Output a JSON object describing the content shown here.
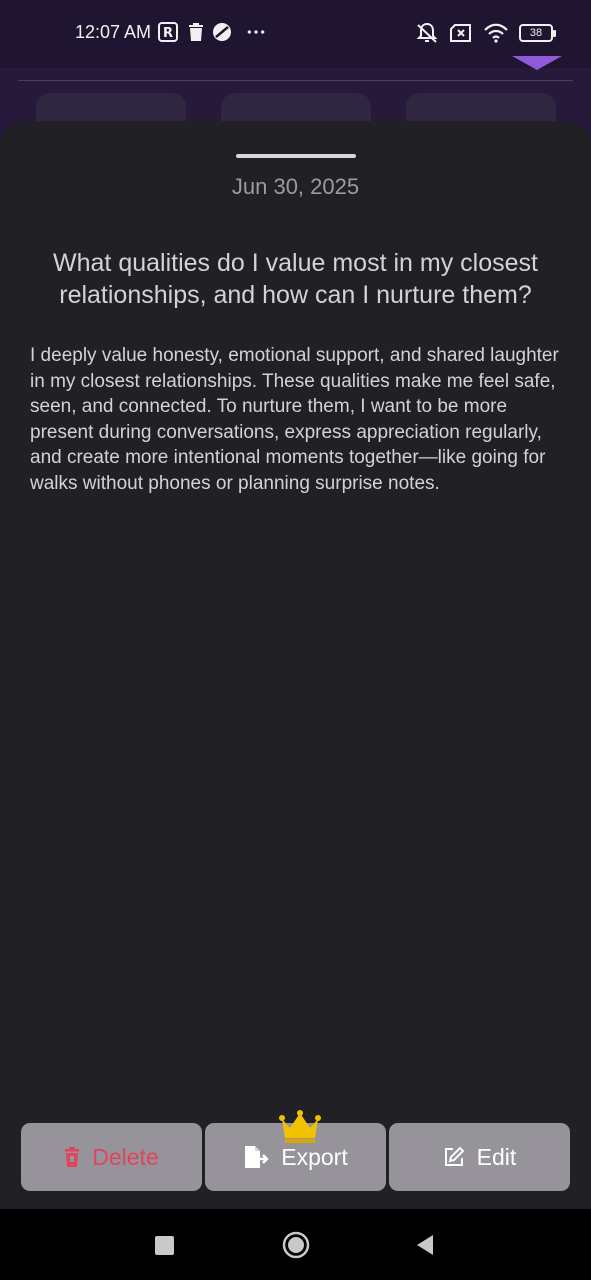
{
  "status_bar": {
    "time": "12:07 AM",
    "battery": "38",
    "icons": [
      "r-badge-icon",
      "trash-icon",
      "globe-icon",
      "more-icon",
      "mute-icon",
      "no-sim-icon",
      "wifi-icon",
      "battery-icon"
    ]
  },
  "entry": {
    "date": "Jun 30, 2025",
    "question": "What qualities do I value most in my closest relationships, and how can I nurture them?",
    "answer": "I deeply value honesty, emotional support, and shared laughter in my closest relationships. These qualities make me feel safe, seen, and connected. To nurture them, I want to be more present during conversations, express appreciation regularly, and create more intentional moments together—like going for walks without phones or planning surprise notes."
  },
  "actions": {
    "delete_label": "Delete",
    "export_label": "Export",
    "edit_label": "Edit",
    "export_badge": "crown-icon"
  },
  "colors": {
    "sheet": "#212025",
    "button": "#96939b",
    "delete": "#e0455e",
    "crown": "#f2c200",
    "accent": "#8e5ad8"
  },
  "nav": {
    "icons": [
      "recents-square-icon",
      "home-circle-icon",
      "back-triangle-icon"
    ]
  }
}
